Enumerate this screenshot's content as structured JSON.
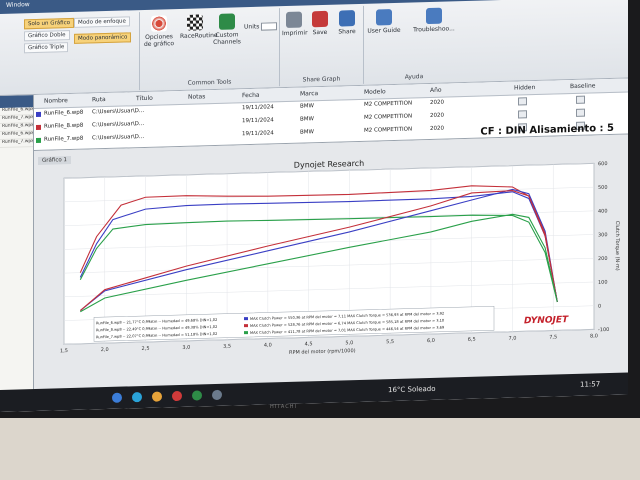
{
  "ribbon": {
    "tab_window": "Window",
    "buttons": {
      "solo_grafico": "Solo un Gráfico",
      "grafico_doble": "Gráfico Doble",
      "grafico_triple": "Gráfico Triple",
      "modo_enfoque": "Modo de enfoque",
      "opciones_grafico": "Opciones de gráfico",
      "modo_panoramico": "Modo panorámico",
      "race_routine": "RaceRoutine",
      "custom_channels": "Custom Channels",
      "units": "Units",
      "imprimir": "Imprimir",
      "save": "Save",
      "share": "Share",
      "user_guide": "User Guide",
      "troubleshooting": "Troubleshoo..."
    },
    "groups": {
      "common_tools": "Common Tools",
      "share_graph": "Share Graph",
      "ayuda": "Ayuda"
    }
  },
  "table": {
    "headers": [
      "Nombre",
      "Ruta",
      "Título",
      "Notas",
      "Fecha",
      "Marca",
      "Modelo",
      "Año",
      "Hidden",
      "Baseline"
    ],
    "rows": [
      {
        "name": "RunFile_6.wp8",
        "path": "C:\\Users\\Usuar\\D...",
        "fecha": "19/11/2024",
        "marca": "BMW",
        "modelo": "M2 COMPETITION",
        "anio": "2020",
        "color": "#3a3fc4"
      },
      {
        "name": "RunFile_8.wp8",
        "path": "C:\\Users\\Usuar\\D...",
        "fecha": "19/11/2024",
        "marca": "BMW",
        "modelo": "M2 COMPETITION",
        "anio": "2020",
        "color": "#c4303a"
      },
      {
        "name": "RunFile_7.wp8",
        "path": "C:\\Users\\Usuar\\D...",
        "fecha": "19/11/2024",
        "marca": "BMW",
        "modelo": "M2 COMPETITION",
        "anio": "2020",
        "color": "#2aa04a"
      }
    ]
  },
  "left_panel": [
    "RunFile_6.wp8",
    "RunFile_7.wp8",
    "RunFile_8.wp8",
    "RunFile_6.wp8",
    "RunFile_7.wp8"
  ],
  "graph": {
    "tab": "Gráfico 1",
    "title": "Dynojet Research",
    "cf": "CF : DIN Alisamiento : 5",
    "xlabel": "RPM del motor  (rpm/1000)",
    "ylabel_right": "Clutch Torque (N·m)",
    "brand": "DYNOJET",
    "legend": [
      {
        "run": "RunFile_6.wp8 -- 21,77°C 0,99atm -- Humedad = 49,68%  DIN=1,02",
        "text": "MAX  Clutch Power = 550,36 at  RPM del motor = 7,11  MAX  Clutch Torque = 536,93 at  RPM del motor = 3,92",
        "color": "#3a3fc4"
      },
      {
        "run": "RunFile_8.wp8 -- 22,49°C 0,99atm -- Humedad = 49,38%  DIN=1,02",
        "text": "MAX  Clutch Power = 528,76 at  RPM del motor = 6,74  MAX  Clutch Torque = 585,18 at  RPM del motor = 3,10",
        "color": "#c4303a"
      },
      {
        "run": "RunFile_7.wp8 -- 22,07°C 0,99atm -- Humedad = 51,18%  DIN=1,02",
        "text": "MAX  Clutch Power = 411,78 at  RPM del motor = 7,01  MAX  Clutch Torque = 446,54 at  RPM del motor = 3,69",
        "color": "#2aa04a"
      }
    ]
  },
  "chart_data": {
    "type": "line",
    "title": "Dynojet Research",
    "xlabel": "RPM del motor  (rpm/1000)",
    "ylabel": "Clutch Torque (N·m)",
    "xlim": [
      1.5,
      8.0
    ],
    "ylim": [
      -100,
      600
    ],
    "x_ticks": [
      "1,5",
      "2,0",
      "2,5",
      "3,0",
      "3,5",
      "4,0",
      "4,5",
      "5,0",
      "5,5",
      "6,0",
      "6,5",
      "7,0",
      "7,5",
      "8,0"
    ],
    "y_ticks": [
      600,
      500,
      400,
      300,
      200,
      100,
      0,
      -100
    ],
    "series": [
      {
        "name": "RunFile_6.wp8",
        "kind": "torque",
        "color": "#3a3fc4",
        "x": [
          1.7,
          1.9,
          2.1,
          2.5,
          3.0,
          3.5,
          4.0,
          5.0,
          6.0,
          6.5,
          7.0,
          7.2,
          7.4,
          7.55
        ],
        "y": [
          180,
          320,
          420,
          460,
          470,
          472,
          470,
          468,
          470,
          475,
          490,
          460,
          300,
          20
        ]
      },
      {
        "name": "RunFile_8.wp8",
        "kind": "torque",
        "color": "#c4303a",
        "x": [
          1.7,
          1.9,
          2.2,
          2.5,
          3.0,
          3.5,
          4.0,
          5.0,
          6.0,
          6.5,
          7.0,
          7.2,
          7.4,
          7.55
        ],
        "y": [
          200,
          350,
          480,
          510,
          512,
          505,
          500,
          498,
          505,
          520,
          510,
          470,
          300,
          20
        ]
      },
      {
        "name": "RunFile_7.wp8",
        "kind": "torque",
        "color": "#2aa04a",
        "x": [
          1.7,
          1.9,
          2.1,
          2.5,
          3.0,
          3.5,
          4.0,
          5.0,
          6.0,
          6.5,
          7.0,
          7.2,
          7.4,
          7.55
        ],
        "y": [
          170,
          300,
          380,
          395,
          398,
          400,
          398,
          396,
          395,
          396,
          390,
          360,
          230,
          20
        ]
      },
      {
        "name": "RunFile_6.wp8",
        "kind": "power",
        "color": "#3a3fc4",
        "x": [
          1.7,
          2.0,
          3.0,
          4.0,
          5.0,
          6.0,
          6.5,
          7.0,
          7.2,
          7.4,
          7.55
        ],
        "y": [
          40,
          120,
          200,
          270,
          340,
          420,
          460,
          500,
          480,
          320,
          20
        ]
      },
      {
        "name": "RunFile_8.wp8",
        "kind": "power",
        "color": "#c4303a",
        "x": [
          1.7,
          2.0,
          3.0,
          4.0,
          5.0,
          6.0,
          6.5,
          7.0,
          7.2,
          7.4,
          7.55
        ],
        "y": [
          40,
          125,
          215,
          290,
          360,
          440,
          490,
          495,
          470,
          310,
          20
        ]
      },
      {
        "name": "RunFile_7.wp8",
        "kind": "power",
        "color": "#2aa04a",
        "x": [
          1.7,
          2.0,
          3.0,
          4.0,
          5.0,
          6.0,
          6.5,
          7.0,
          7.2,
          7.4,
          7.55
        ],
        "y": [
          35,
          90,
          155,
          215,
          275,
          330,
          370,
          395,
          380,
          250,
          20
        ]
      }
    ]
  },
  "taskbar": {
    "weather": "16°C  Soleado",
    "time": "11:57"
  },
  "monitor_brand": "HITACHI"
}
